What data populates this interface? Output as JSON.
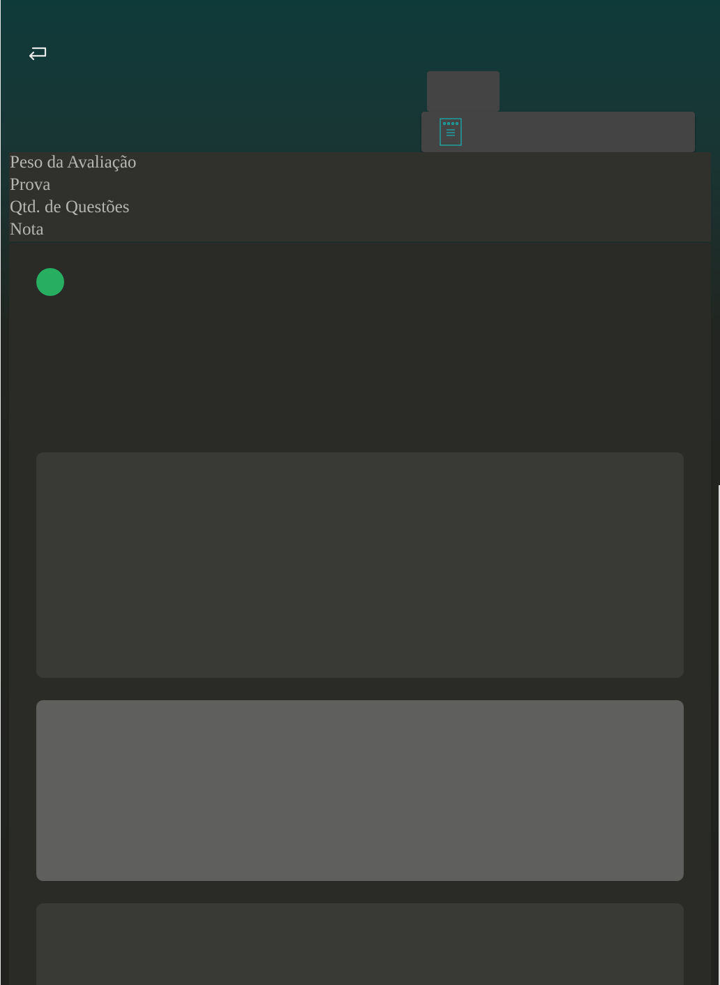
{
  "header": {
    "back_icon": "return-arrow-icon",
    "doc_icon": "document-notepad-icon",
    "accent_color": "#12b5b5"
  },
  "info": {
    "weight_label": "Peso da Avaliação",
    "exam_label": "Prova",
    "questions_label": "Qtd. de Questões",
    "grade_label": "Nota"
  },
  "status": {
    "indicator_color": "#27ae60"
  }
}
